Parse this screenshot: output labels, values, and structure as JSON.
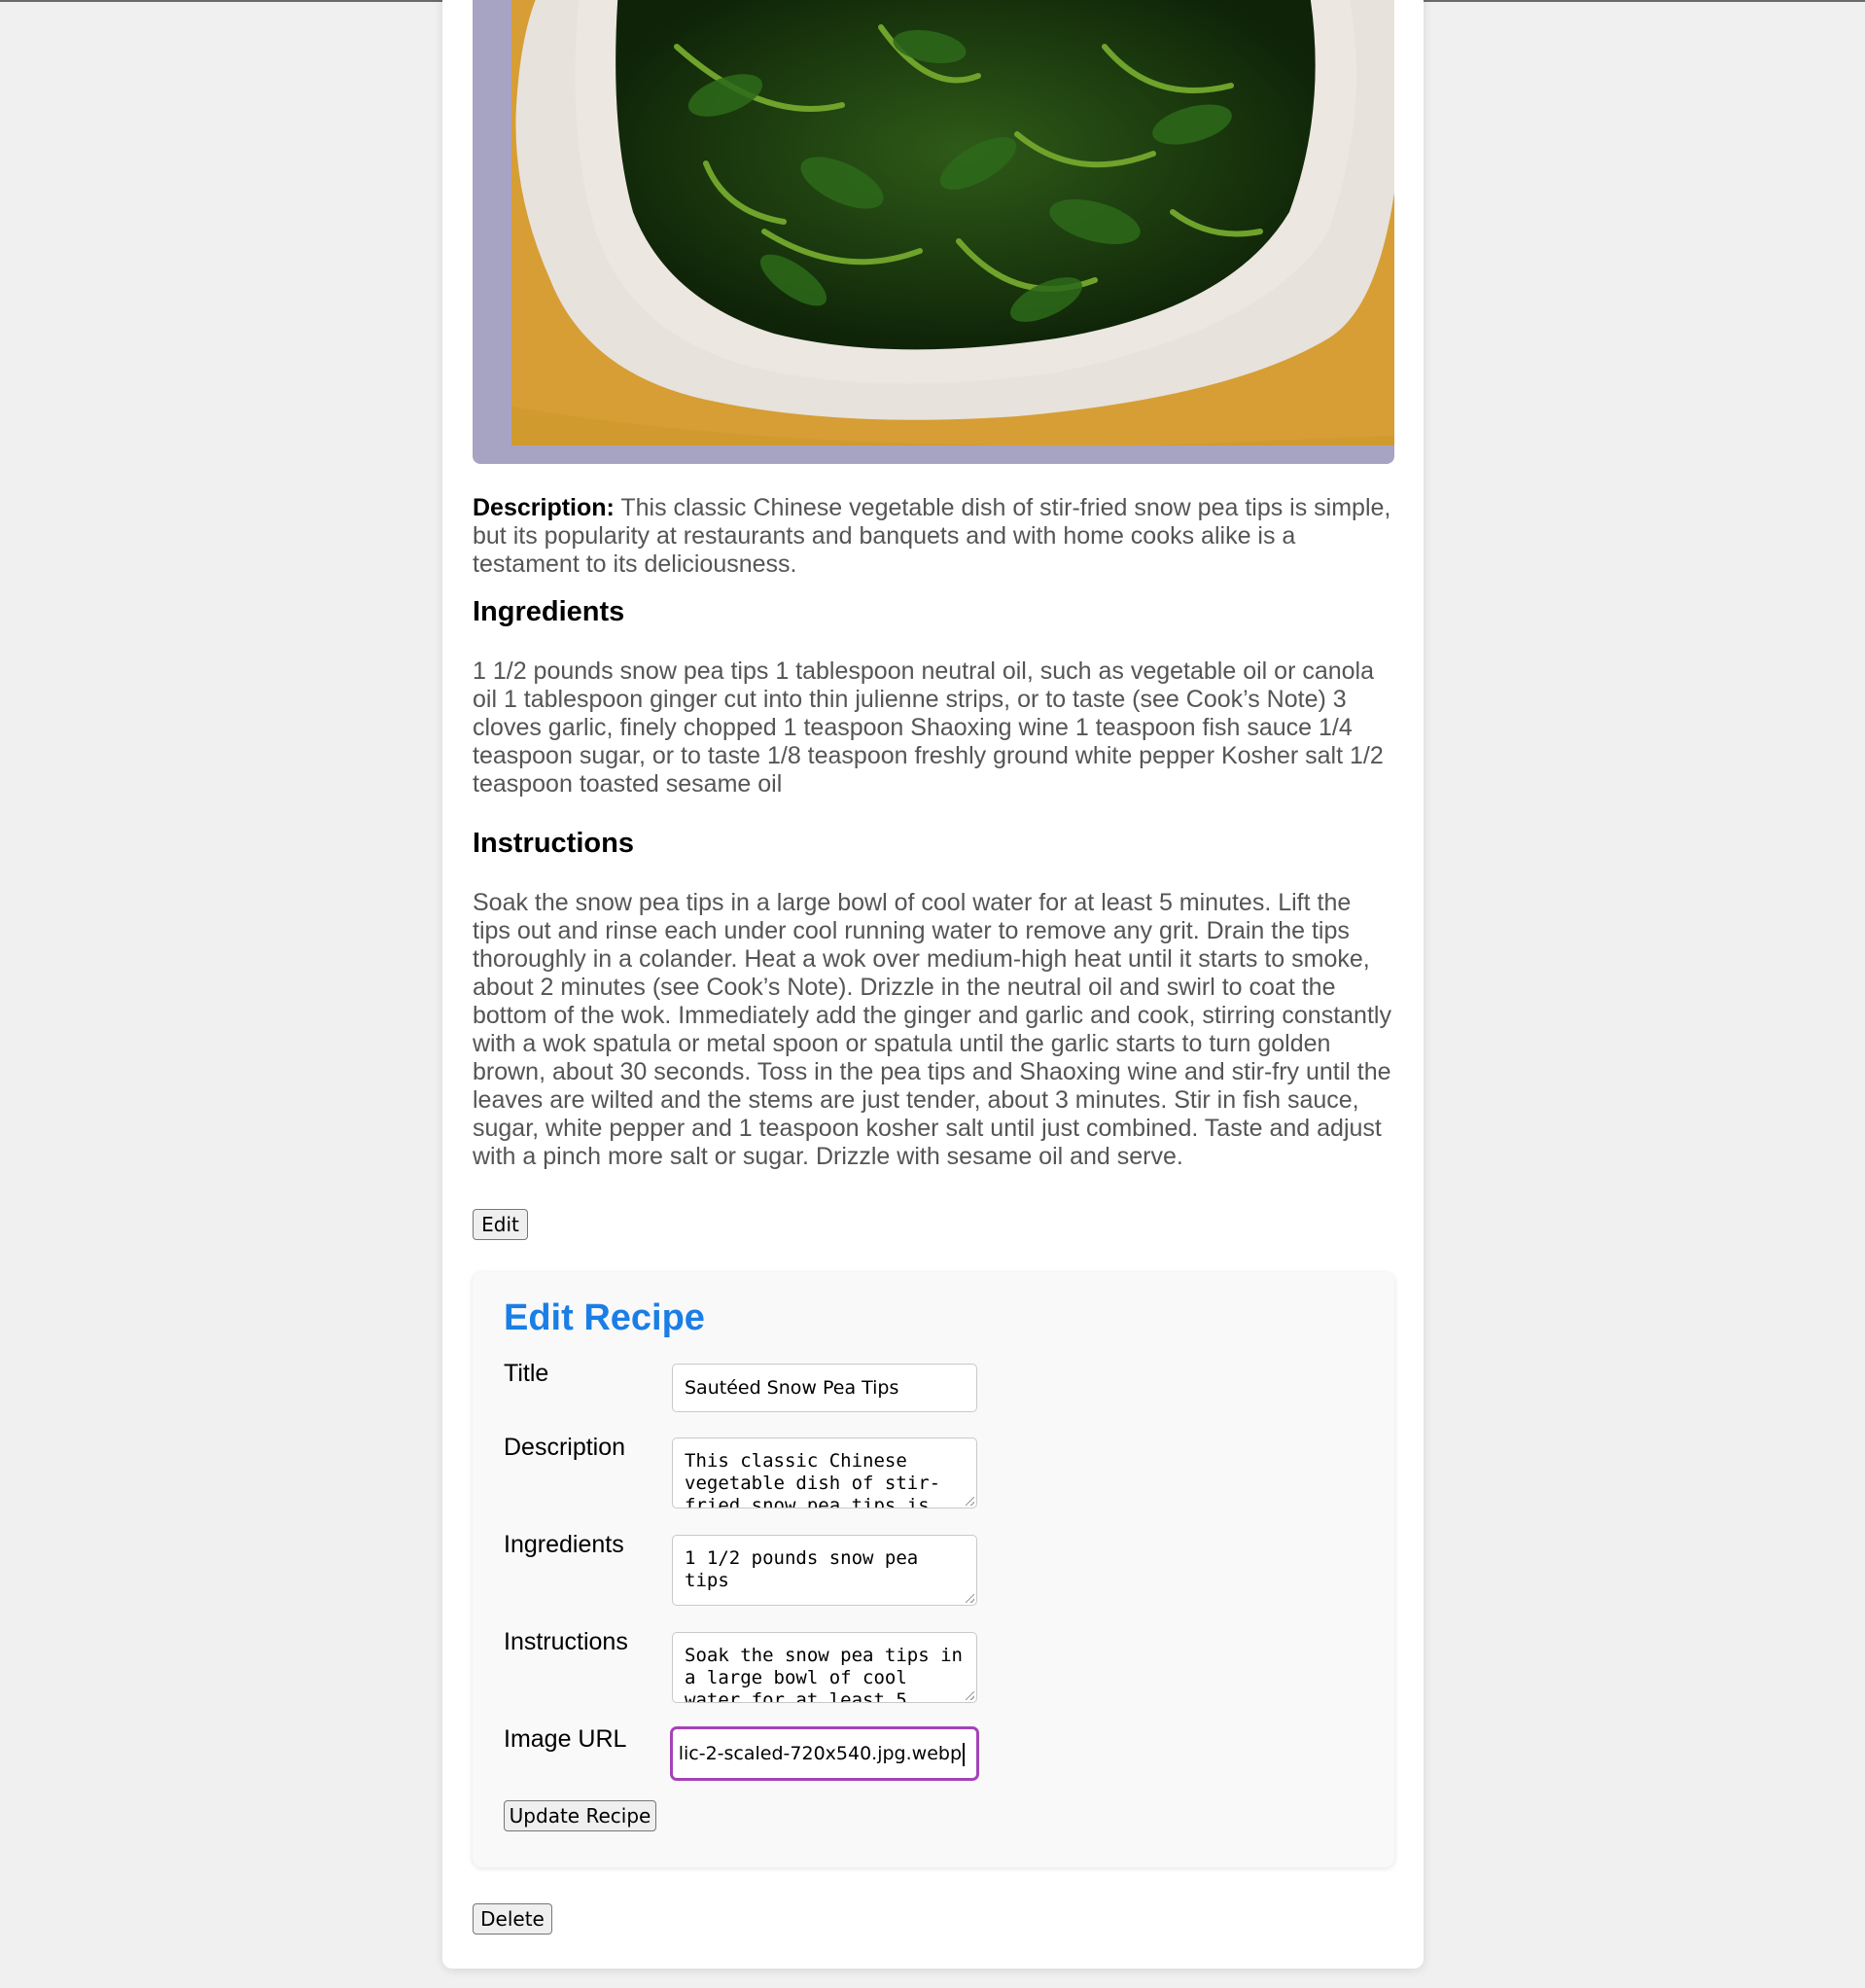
{
  "recipe": {
    "image_alt": "Sautéed snow pea tips on a white plate",
    "description_label": "Description:",
    "description": "This classic Chinese vegetable dish of stir-fried snow pea tips is simple, but its popularity at restaurants and banquets and with home cooks alike is a testament to its deliciousness.",
    "ingredients_heading": "Ingredients",
    "ingredients": "1 1/2 pounds snow pea tips 1 tablespoon neutral oil, such as vegetable oil or canola oil 1 tablespoon ginger cut into thin julienne strips, or to taste (see Cook’s Note) 3 cloves garlic, finely chopped 1 teaspoon Shaoxing wine 1 teaspoon fish sauce 1/4 teaspoon sugar, or to taste 1/8 teaspoon freshly ground white pepper Kosher salt 1/2 teaspoon toasted sesame oil",
    "instructions_heading": "Instructions",
    "instructions": "Soak the snow pea tips in a large bowl of cool water for at least 5 minutes. Lift the tips out and rinse each under cool running water to remove any grit. Drain the tips thoroughly in a colander. Heat a wok over medium-high heat until it starts to smoke, about 2 minutes (see Cook’s Note). Drizzle in the neutral oil and swirl to coat the bottom of the wok. Immediately add the ginger and garlic and cook, stirring constantly with a wok spatula or metal spoon or spatula until the garlic starts to turn golden brown, about 30 seconds. Toss in the pea tips and Shaoxing wine and stir-fry until the leaves are wilted and the stems are just tender, about 3 minutes. Stir in fish sauce, sugar, white pepper and 1 teaspoon kosher salt until just combined. Taste and adjust with a pinch more salt or sugar. Drizzle with sesame oil and serve."
  },
  "buttons": {
    "edit": "Edit",
    "update": "Update Recipe",
    "delete": "Delete"
  },
  "edit_form": {
    "heading": "Edit Recipe",
    "title_label": "Title",
    "title_value": "Sautéed Snow Pea Tips",
    "description_label": "Description",
    "description_value": "This classic Chinese vegetable dish of stir-fried snow pea tips is",
    "ingredients_label": "Ingredients",
    "ingredients_value": "1 1/2 pounds snow pea tips",
    "instructions_label": "Instructions",
    "instructions_value": "Soak the snow pea tips in a large bowl of cool water for at least 5",
    "image_url_label": "Image URL",
    "image_url_value": "lic-2-scaled-720x540.jpg.webp"
  },
  "colors": {
    "accent": "#1a7ee6",
    "focus_ring": "#a442b8"
  }
}
